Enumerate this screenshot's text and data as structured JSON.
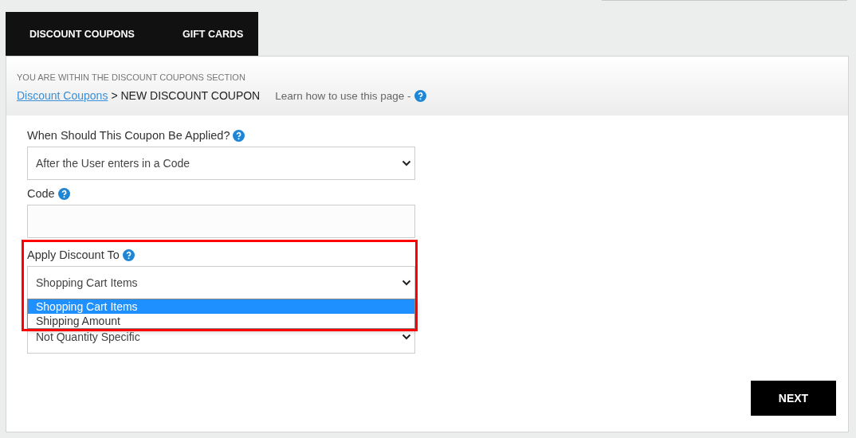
{
  "tabs": [
    {
      "label": "DISCOUNT COUPONS"
    },
    {
      "label": "GIFT CARDS"
    }
  ],
  "header": {
    "section_note": "YOU ARE WITHIN THE DISCOUNT COUPONS SECTION",
    "breadcrumb_link": "Discount Coupons",
    "breadcrumb_current": "> NEW DISCOUNT COUPON",
    "help_text": "Learn how to use this page -"
  },
  "fields": [
    {
      "kind": "select",
      "label": "When Should This Coupon Be Applied?",
      "value": "After the User enters in a Code"
    },
    {
      "kind": "input",
      "label": "Code"
    },
    {
      "kind": "select",
      "label": "Apply Discount To",
      "value": "Shopping Cart Items",
      "highlighted": true,
      "open": true,
      "options": [
        {
          "label": "Shopping Cart Items",
          "selected": true
        },
        {
          "label": "Shipping Amount",
          "selected": false
        }
      ]
    },
    {
      "kind": "select",
      "value": "Not Quantity Specific"
    }
  ],
  "next_button": "NEXT"
}
